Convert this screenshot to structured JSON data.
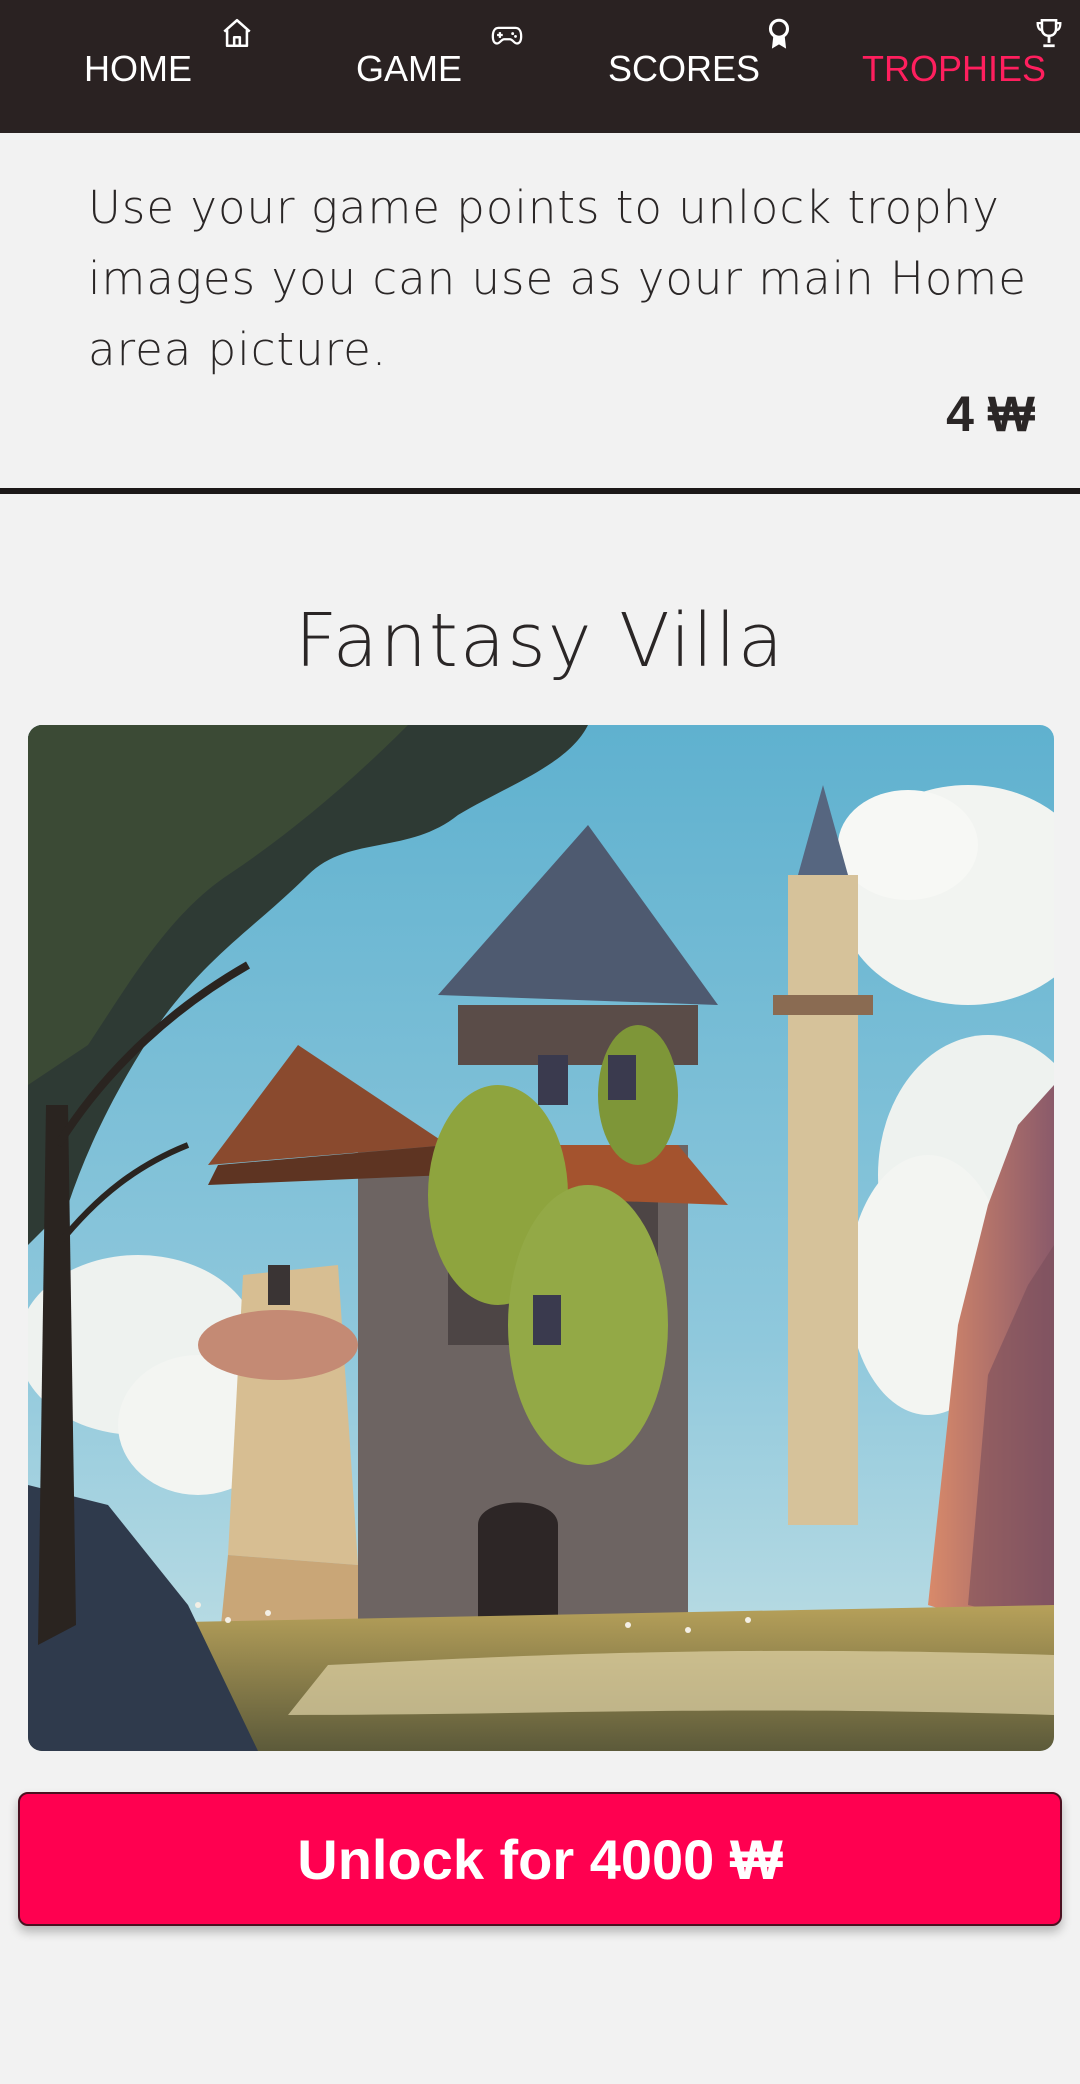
{
  "nav": {
    "items": [
      {
        "label": "HOME",
        "icon": "home-icon",
        "active": false
      },
      {
        "label": "GAME",
        "icon": "gamepad-icon",
        "active": false
      },
      {
        "label": "SCORES",
        "icon": "award-icon",
        "active": false
      },
      {
        "label": "TROPHIES",
        "icon": "trophy-icon",
        "active": true
      }
    ],
    "active_color": "#ff1f5e",
    "background": "#2a2222"
  },
  "intro": {
    "text": "Use your game points to unlock trophy images you can use as your main Home area picture."
  },
  "balance": {
    "text": "4 ₩"
  },
  "trophy": {
    "title": "Fantasy Villa",
    "image": "fantasy-villa-illustration",
    "unlock_label": "Unlock for 4000 ₩",
    "button_color": "#ff0050"
  }
}
